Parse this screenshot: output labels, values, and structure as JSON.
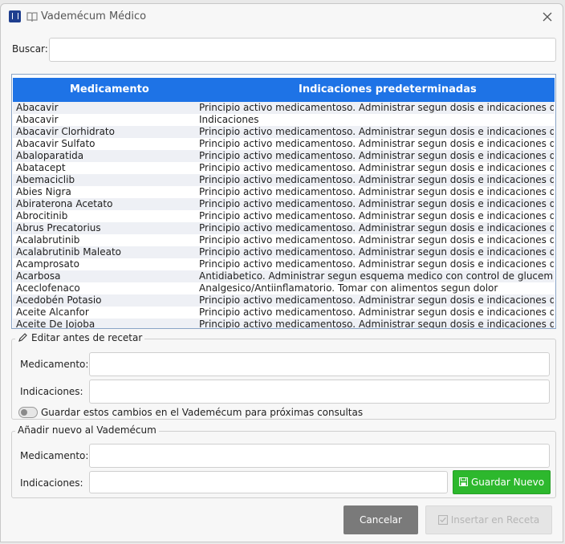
{
  "window": {
    "title": "Vademécum Médico"
  },
  "search": {
    "label": "Buscar:",
    "value": ""
  },
  "table": {
    "headers": [
      "Medicamento",
      "Indicaciones predeterminadas"
    ],
    "rows": [
      [
        "Abacavir",
        "Principio activo medicamentoso. Administrar segun dosis e indicaciones del medico"
      ],
      [
        "Abacavir",
        "Indicaciones"
      ],
      [
        "Abacavir Clorhidrato",
        "Principio activo medicamentoso. Administrar segun dosis e indicaciones del medico"
      ],
      [
        "Abacavir Sulfato",
        "Principio activo medicamentoso. Administrar segun dosis e indicaciones del medico"
      ],
      [
        "Abaloparatida",
        "Principio activo medicamentoso. Administrar segun dosis e indicaciones del medico"
      ],
      [
        "Abatacept",
        "Principio activo medicamentoso. Administrar segun dosis e indicaciones del medico"
      ],
      [
        "Abemaciclib",
        "Principio activo medicamentoso. Administrar segun dosis e indicaciones del medico"
      ],
      [
        "Abies Nigra",
        "Principio activo medicamentoso. Administrar segun dosis e indicaciones del medico"
      ],
      [
        "Abiraterona Acetato",
        "Principio activo medicamentoso. Administrar segun dosis e indicaciones del medico"
      ],
      [
        "Abrocitinib",
        "Principio activo medicamentoso. Administrar segun dosis e indicaciones del medico"
      ],
      [
        "Abrus Precatorius",
        "Principio activo medicamentoso. Administrar segun dosis e indicaciones del medico"
      ],
      [
        "Acalabrutinib",
        "Principio activo medicamentoso. Administrar segun dosis e indicaciones del medico"
      ],
      [
        "Acalabrutinib Maleato",
        "Principio activo medicamentoso. Administrar segun dosis e indicaciones del medico"
      ],
      [
        "Acamprosato",
        "Principio activo medicamentoso. Administrar segun dosis e indicaciones del medico"
      ],
      [
        "Acarbosa",
        "Antidiabetico. Administrar segun esquema medico con control de glucemia"
      ],
      [
        "Aceclofenaco",
        "Analgesico/Antiinflamatorio. Tomar con alimentos segun dolor"
      ],
      [
        "Acedobén Potasio",
        "Principio activo medicamentoso. Administrar segun dosis e indicaciones del medico"
      ],
      [
        "Aceite Alcanfor",
        "Principio activo medicamentoso. Administrar segun dosis e indicaciones del medico"
      ],
      [
        "Aceite De Jojoba",
        "Principio activo medicamentoso. Administrar segun dosis e indicaciones del medico"
      ]
    ]
  },
  "edit_section": {
    "legend": "Editar antes de recetar",
    "med_label": "Medicamento:",
    "ind_label": "Indicaciones:",
    "med_value": "",
    "ind_value": "",
    "save_toggle_label": "Guardar estos cambios en el Vademécum para próximas consultas",
    "save_toggle_on": false
  },
  "add_section": {
    "legend": "Añadir nuevo al Vademécum",
    "med_label": "Medicamento:",
    "ind_label": "Indicaciones:",
    "med_value": "",
    "ind_value": "",
    "save_button": "Guardar Nuevo"
  },
  "footer": {
    "cancel_button": "Cancelar",
    "insert_button": "Insertar en Receta"
  },
  "colors": {
    "header_blue": "#1e73e6",
    "save_green": "#2db82d",
    "cancel_gray": "#7a7a7a"
  }
}
